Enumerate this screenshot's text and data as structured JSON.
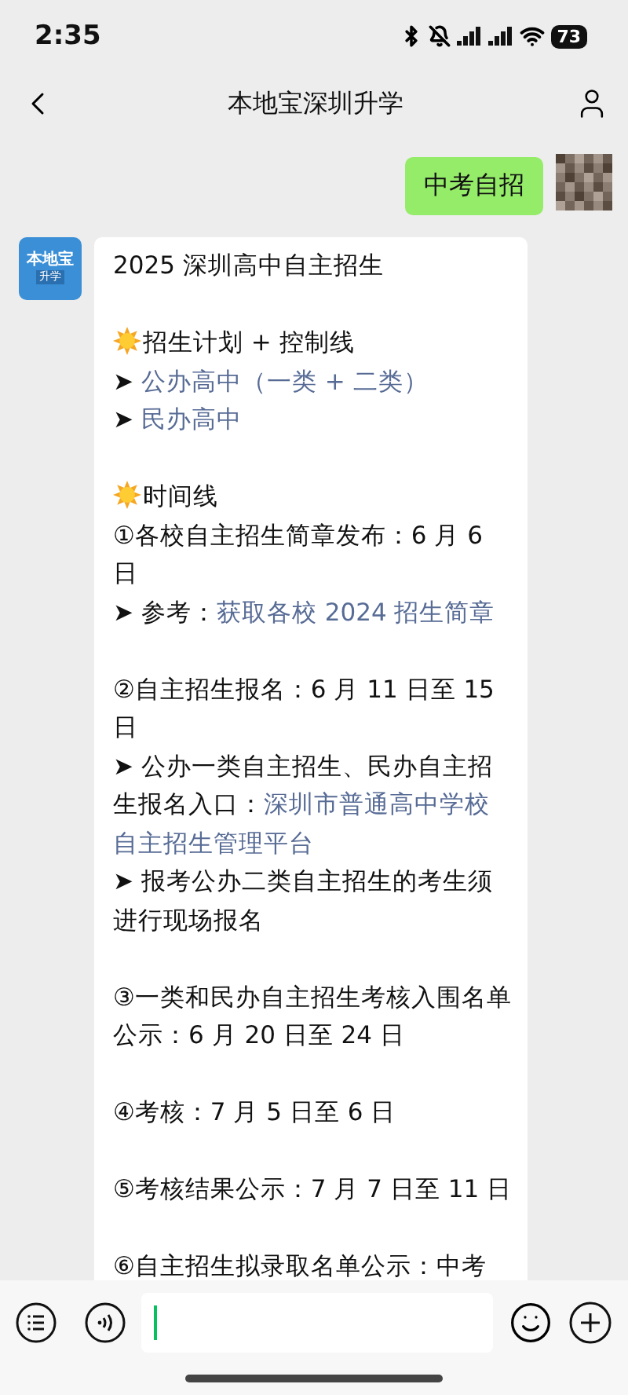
{
  "status_bar": {
    "time": "2:35",
    "battery": "73"
  },
  "header": {
    "title": "本地宝深圳升学"
  },
  "outgoing": {
    "text": "中考自招"
  },
  "incoming": {
    "avatar_texts": [
      "本地宝",
      "升学"
    ],
    "paragraphs": [
      {
        "lines": [
          {
            "kind": "plain",
            "segments": [
              {
                "text": "2025 深圳高中自主招生",
                "link": false
              }
            ]
          }
        ]
      },
      {
        "lines": [
          {
            "kind": "heading",
            "segments": [
              {
                "text": "招生计划 + 控制线",
                "link": false
              }
            ]
          },
          {
            "kind": "bullet",
            "marker": "➤",
            "segments": [
              {
                "text": "公办高中（一类 + 二类）",
                "link": true
              }
            ]
          },
          {
            "kind": "bullet",
            "marker": "➤",
            "segments": [
              {
                "text": "民办高中",
                "link": true
              }
            ]
          }
        ]
      },
      {
        "lines": [
          {
            "kind": "heading",
            "segments": [
              {
                "text": "时间线",
                "link": false
              }
            ]
          },
          {
            "kind": "plain",
            "segments": [
              {
                "text": "①各校自主招生简章发布：6 月 6 日",
                "link": false
              }
            ]
          },
          {
            "kind": "bullet",
            "marker": "➤",
            "segments": [
              {
                "text": "参考：",
                "link": false
              },
              {
                "text": "获取各校 2024 招生简章",
                "link": true
              }
            ]
          }
        ]
      },
      {
        "lines": [
          {
            "kind": "plain",
            "segments": [
              {
                "text": "②自主招生报名：6 月 11 日至 15 日",
                "link": false
              }
            ]
          },
          {
            "kind": "bullet",
            "marker": "➤",
            "segments": [
              {
                "text": "公办一类自主招生、民办自主招生报名入口：",
                "link": false
              },
              {
                "text": "深圳市普通高中学校",
                "link": true
              },
              {
                "text": "自主招生管理平台",
                "link": true
              }
            ]
          },
          {
            "kind": "bullet",
            "marker": "➤",
            "segments": [
              {
                "text": "报考公办二类自主招生的考生须进行现场报名",
                "link": false
              }
            ]
          }
        ]
      },
      {
        "lines": [
          {
            "kind": "plain",
            "segments": [
              {
                "text": "③一类和民办自主招生考核入围名单公示：6 月 20 日至 24 日",
                "link": false
              }
            ]
          }
        ]
      },
      {
        "lines": [
          {
            "kind": "plain",
            "segments": [
              {
                "text": "④考核：7 月 5 日至 6 日",
                "link": false
              }
            ]
          }
        ]
      },
      {
        "lines": [
          {
            "kind": "plain",
            "segments": [
              {
                "text": "⑤考核结果公示：7 月 7 日至 11 日",
                "link": false
              }
            ]
          }
        ]
      },
      {
        "lines": [
          {
            "kind": "plain",
            "segments": [
              {
                "text": "⑥自主招生拟录取名单公示：中考",
                "link": false
              }
            ]
          }
        ]
      }
    ]
  },
  "input": {
    "focused": true
  }
}
